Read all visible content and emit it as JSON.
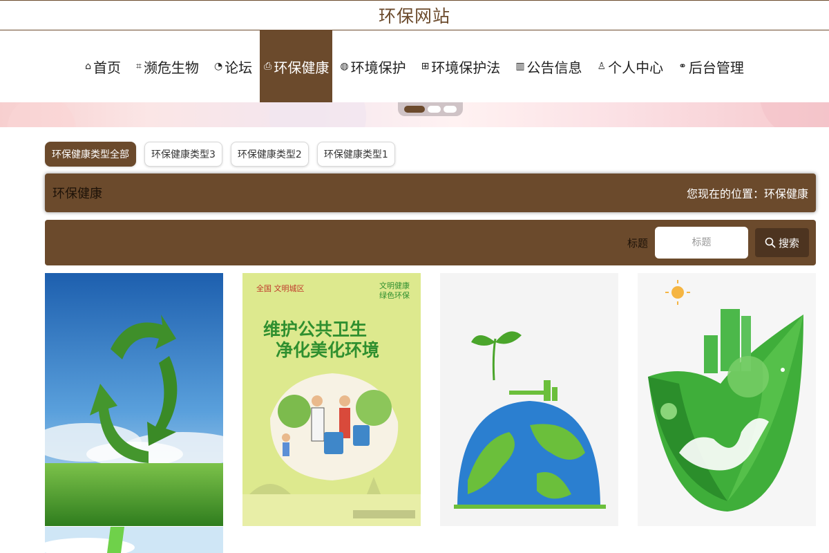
{
  "site": {
    "title": "环保网站"
  },
  "nav": {
    "items": [
      {
        "label": "首页",
        "icon": "home-icon",
        "glyph": "⌂"
      },
      {
        "label": "濒危生物",
        "icon": "tag-icon",
        "glyph": "⌗"
      },
      {
        "label": "论坛",
        "icon": "gauge-icon",
        "glyph": "◔"
      },
      {
        "label": "环保健康",
        "icon": "printer-icon",
        "glyph": "⎙",
        "active": true
      },
      {
        "label": "环境保护",
        "icon": "globe-icon",
        "glyph": "◍"
      },
      {
        "label": "环境保护法",
        "icon": "apps-icon",
        "glyph": "⊞"
      },
      {
        "label": "公告信息",
        "icon": "map-icon",
        "glyph": "▥"
      },
      {
        "label": "个人中心",
        "icon": "user-icon",
        "glyph": "♙"
      },
      {
        "label": "后台管理",
        "icon": "link-icon",
        "glyph": "⚭"
      }
    ]
  },
  "carousel": {
    "slides": 3,
    "active_slide": 1
  },
  "filters": {
    "items": [
      {
        "label": "环保健康类型全部",
        "active": true
      },
      {
        "label": "环保健康类型3"
      },
      {
        "label": "环保健康类型2"
      },
      {
        "label": "环保健康类型1"
      }
    ]
  },
  "breadcrumb": {
    "title": "环保健康",
    "location": "您现在的位置：环保健康"
  },
  "search": {
    "label": "标题",
    "placeholder": "标题",
    "button_label": "搜索"
  },
  "cards": [
    {
      "name": "recycle-arrows-card"
    },
    {
      "name": "poster-card",
      "top_left": "全国 文明城区",
      "top_right_1": "文明健康",
      "top_right_2": "绿色环保",
      "headline_1": "维护公共卫生",
      "headline_2": "净化美化环境"
    },
    {
      "name": "earth-sprout-card"
    },
    {
      "name": "green-city-leaf-card"
    }
  ],
  "colors": {
    "primary": "#6b4a2c",
    "primary_dark": "#4d3420",
    "poster_green": "#2f8f2f"
  }
}
